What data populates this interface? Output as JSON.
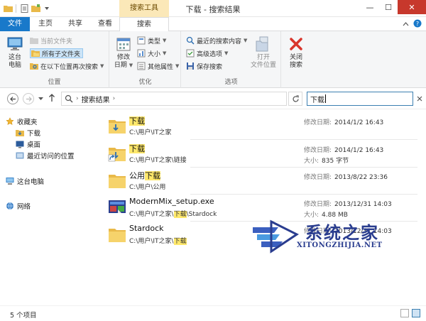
{
  "window": {
    "title": "下载 - 搜索结果",
    "context_tab_group": "搜索工具",
    "minimize": "—",
    "maximize": "☐",
    "close": "✕"
  },
  "ribbon_tabs": [
    "文件",
    "主页",
    "共享",
    "查看",
    "搜索"
  ],
  "ribbon": {
    "location_group": {
      "label": "位置",
      "this_pc": [
        "这台",
        "电脑"
      ],
      "current_folder": "当前文件夹",
      "all_subfolders": "所有子文件夹",
      "search_again": "在以下位置再次搜索"
    },
    "refine_group": {
      "label": "优化",
      "date_modified": [
        "修改",
        "日期"
      ],
      "kind": "类型",
      "size": "大小",
      "other_properties": "其他属性"
    },
    "options_group": {
      "label": "选项",
      "recent_searches": "最近的搜索内容",
      "advanced_options": "高级选项",
      "save_search": "保存搜索",
      "open_location": [
        "打开",
        "文件位置"
      ]
    },
    "close_group": {
      "close_search": [
        "关闭",
        "搜索"
      ]
    }
  },
  "address": {
    "crumb": "搜索结果",
    "search_value": "下载"
  },
  "nav_pane": {
    "favorites": "收藏夹",
    "downloads": "下载",
    "desktop": "桌面",
    "recent": "最近访问的位置",
    "this_pc": "这台电脑",
    "network": "网络"
  },
  "items": [
    {
      "name_pre": "",
      "name_hl": "下载",
      "name_post": "",
      "path_pre": "C:\\用户\\IT之家",
      "path_hl": "",
      "path_post": "",
      "meta1_label": "修改日期:",
      "meta1_value": "2014/1/2 16:43",
      "meta2_label": "",
      "meta2_value": "",
      "icon": "folder-icon"
    },
    {
      "name_pre": "",
      "name_hl": "下载",
      "name_post": "",
      "path_pre": "C:\\用户\\IT之家\\链接",
      "path_hl": "",
      "path_post": "",
      "meta1_label": "修改日期:",
      "meta1_value": "2014/1/2 16:43",
      "meta2_label": "大小:",
      "meta2_value": "835 字节",
      "icon": "shortcut-icon"
    },
    {
      "name_pre": "公用",
      "name_hl": "下载",
      "name_post": "",
      "path_pre": "C:\\用户\\公用",
      "path_hl": "",
      "path_post": "",
      "meta1_label": "修改日期:",
      "meta1_value": "2013/8/22 23:36",
      "meta2_label": "",
      "meta2_value": "",
      "icon": "folder-icon"
    },
    {
      "name_pre": "ModernMix_setup.exe",
      "name_hl": "",
      "name_post": "",
      "path_pre": "C:\\用户\\IT之家\\",
      "path_hl": "下载",
      "path_post": "\\Stardock",
      "meta1_label": "修改日期:",
      "meta1_value": "2013/12/31 14:03",
      "meta2_label": "大小:",
      "meta2_value": "4.88 MB",
      "icon": "installer-icon"
    },
    {
      "name_pre": "Stardock",
      "name_hl": "",
      "name_post": "",
      "path_pre": "C:\\用户\\IT之家\\",
      "path_hl": "下载",
      "path_post": "",
      "meta1_label": "修改日期:",
      "meta1_value": "2013/12/31 14:03",
      "meta2_label": "",
      "meta2_value": "",
      "icon": "folder-icon"
    }
  ],
  "status": {
    "count": "5 个项目"
  },
  "watermark": {
    "title": "系统之家",
    "subtitle": "XITONGZHIJIA.NET"
  },
  "colors": {
    "file_tab": "#1979ca",
    "highlight": "#ffe86b",
    "context_tab": "#fbe8b8",
    "folder": "#f1c34f",
    "watermark": "#2a3d8f"
  }
}
